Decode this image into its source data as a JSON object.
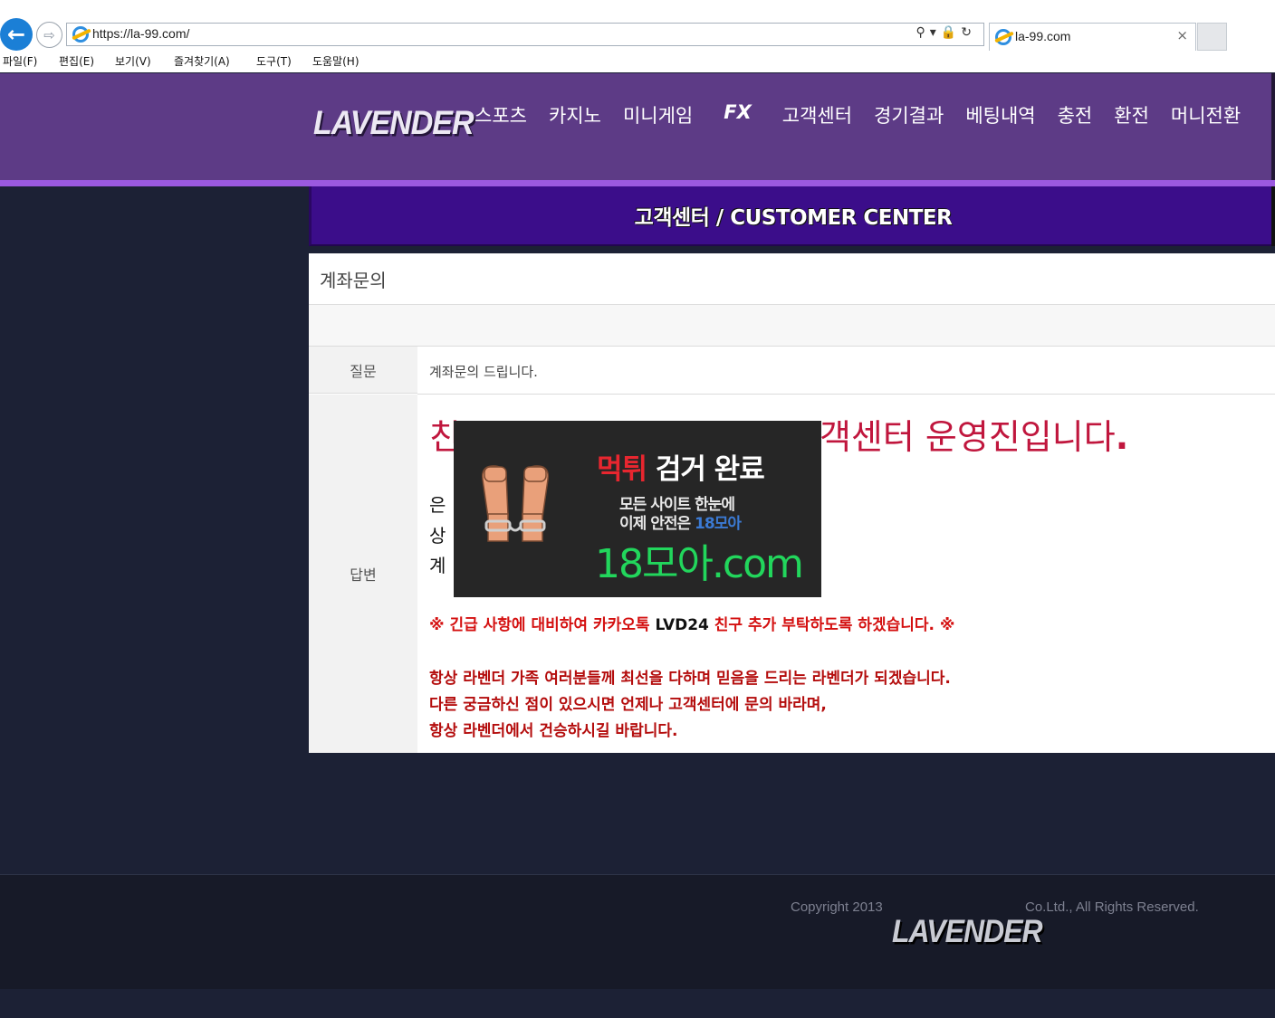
{
  "browser": {
    "url": "https://la-99.com/",
    "tab_title": "la-99.com",
    "tab_close": "×",
    "menu": [
      "파일(F)",
      "편집(E)",
      "보기(V)",
      "즐겨찾기(A)",
      "도구(T)",
      "도움말(H)"
    ]
  },
  "header": {
    "logo_text": "LAVENDER",
    "nav": [
      "스포츠",
      "카지노",
      "미니게임",
      "FX",
      "고객센터",
      "경기결과",
      "베팅내역",
      "충전",
      "환전",
      "머니전환"
    ]
  },
  "banner": {
    "title": "고객센터 / CUSTOMER CENTER"
  },
  "post": {
    "title": "계좌문의",
    "question_label": "질문",
    "question_text": "계좌문의 드립니다.",
    "answer_label": "답변",
    "answer_heading_start": "친",
    "answer_heading_end": "객센터 운영진입니다",
    "answer_heading_dot": ".",
    "answer_lines": [
      "은",
      "상",
      "계"
    ],
    "notice_prefix": "※ 긴급 사항에 대비하여 카카오톡 ",
    "notice_kakao_id": "LVD24",
    "notice_suffix": " 친구 추가 부탁하도록 하겠습니다. ※",
    "closing_lines": [
      "항상 라벤더 가족 여러분들께 최선을 다하며 믿음을 드리는 라벤더가 되겠습니다.",
      "다른 궁금하신 점이 있으시면 언제나 고객센터에 문의 바라며,",
      "항상 라벤더에서 건승하시길 바랍니다."
    ]
  },
  "watermark": {
    "caught_red": "먹튀",
    "caught_rest": " 검거 완료",
    "line1": "모든 사이트 한눈에",
    "line2_prefix": "이제 안전은 ",
    "line2_brand": "18모아",
    "domain": "18모아.com"
  },
  "footer": {
    "copyright": "Copyright 2013",
    "rights": "Co.Ltd., All Rights Reserved.",
    "logo_text": "LAVENDER"
  },
  "colors": {
    "header_bg": "#5d3b86",
    "header_stripe": "#9b59e0",
    "banner_bg": "#3b0d8a",
    "page_bg": "#1c2135",
    "heading_red": "#c0163d",
    "notice_red": "#d41010",
    "ad_green": "#22d65c"
  }
}
